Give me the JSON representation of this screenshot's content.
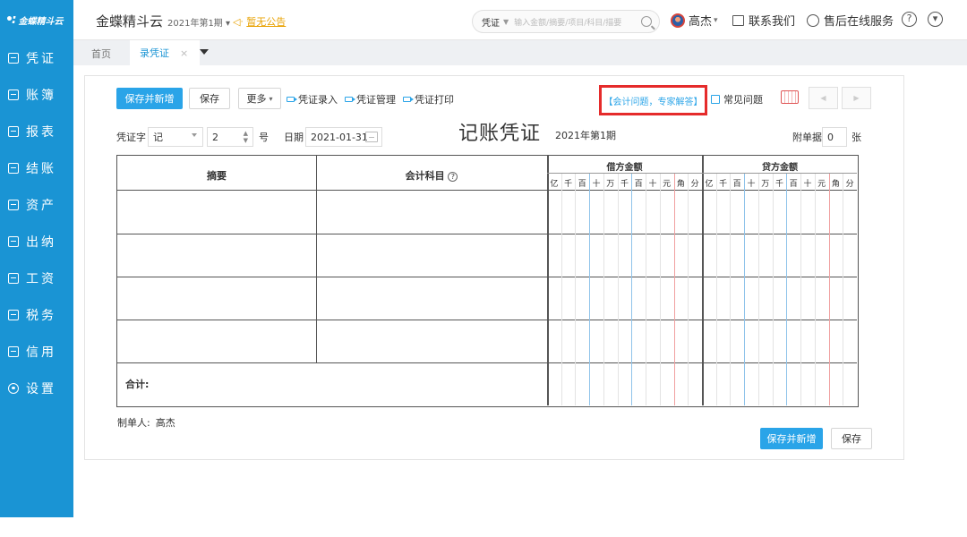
{
  "sidebar": {
    "logo": "金蝶精斗云",
    "items": [
      {
        "label": "凭证",
        "icon": "voucher-icon"
      },
      {
        "label": "账簿",
        "icon": "ledger-icon"
      },
      {
        "label": "报表",
        "icon": "report-icon"
      },
      {
        "label": "结账",
        "icon": "closing-icon"
      },
      {
        "label": "资产",
        "icon": "assets-icon"
      },
      {
        "label": "出纳",
        "icon": "cashier-icon"
      },
      {
        "label": "工资",
        "icon": "payroll-icon"
      },
      {
        "label": "税务",
        "icon": "tax-icon"
      },
      {
        "label": "信用",
        "icon": "credit-icon"
      },
      {
        "label": "设置",
        "icon": "gear-icon"
      }
    ],
    "bg_color": "#1a94d4"
  },
  "header": {
    "app_title": "金蝶精斗云",
    "period": "2021年第1期",
    "notice": "暂无公告",
    "search_kind": "凭证",
    "search_placeholder": "输入金额/摘要/项目/科目/描要",
    "user_name": "高杰",
    "contact": "联系我们",
    "support": "售后在线服务"
  },
  "tabs": {
    "home": "首页",
    "active": "录凭证",
    "close": "×"
  },
  "toolbar": {
    "save_new": "保存并新增",
    "save": "保存",
    "more": "更多",
    "entry": "凭证录入",
    "manage": "凭证管理",
    "print": "凭证打印",
    "expert": "【会计问题，专家解答】",
    "faq": "常见问题",
    "prev": "◀",
    "next": "▶"
  },
  "voucher": {
    "word_label": "凭证字",
    "word_value": "记",
    "number_value": "2",
    "number_unit": "号",
    "date_label": "日期",
    "date_value": "2021-01-31",
    "title": "记账凭证",
    "period": "2021年第1期",
    "attach_label": "附单据",
    "attach_value": "0",
    "attach_unit": "张"
  },
  "table": {
    "col_summary": "摘要",
    "col_account": "会计科目",
    "col_debit": "借方金额",
    "col_credit": "贷方金额",
    "digits": [
      "亿",
      "千",
      "百",
      "十",
      "万",
      "千",
      "百",
      "十",
      "元",
      "角",
      "分"
    ],
    "total_label": "合计:"
  },
  "footer": {
    "maker_label": "制单人:",
    "maker_value": "高杰",
    "save_new": "保存并新增",
    "save": "保存"
  },
  "colors": {
    "accent": "#2aa4e8",
    "highlight_box": "#e52b2b",
    "notice": "#e8a100"
  }
}
